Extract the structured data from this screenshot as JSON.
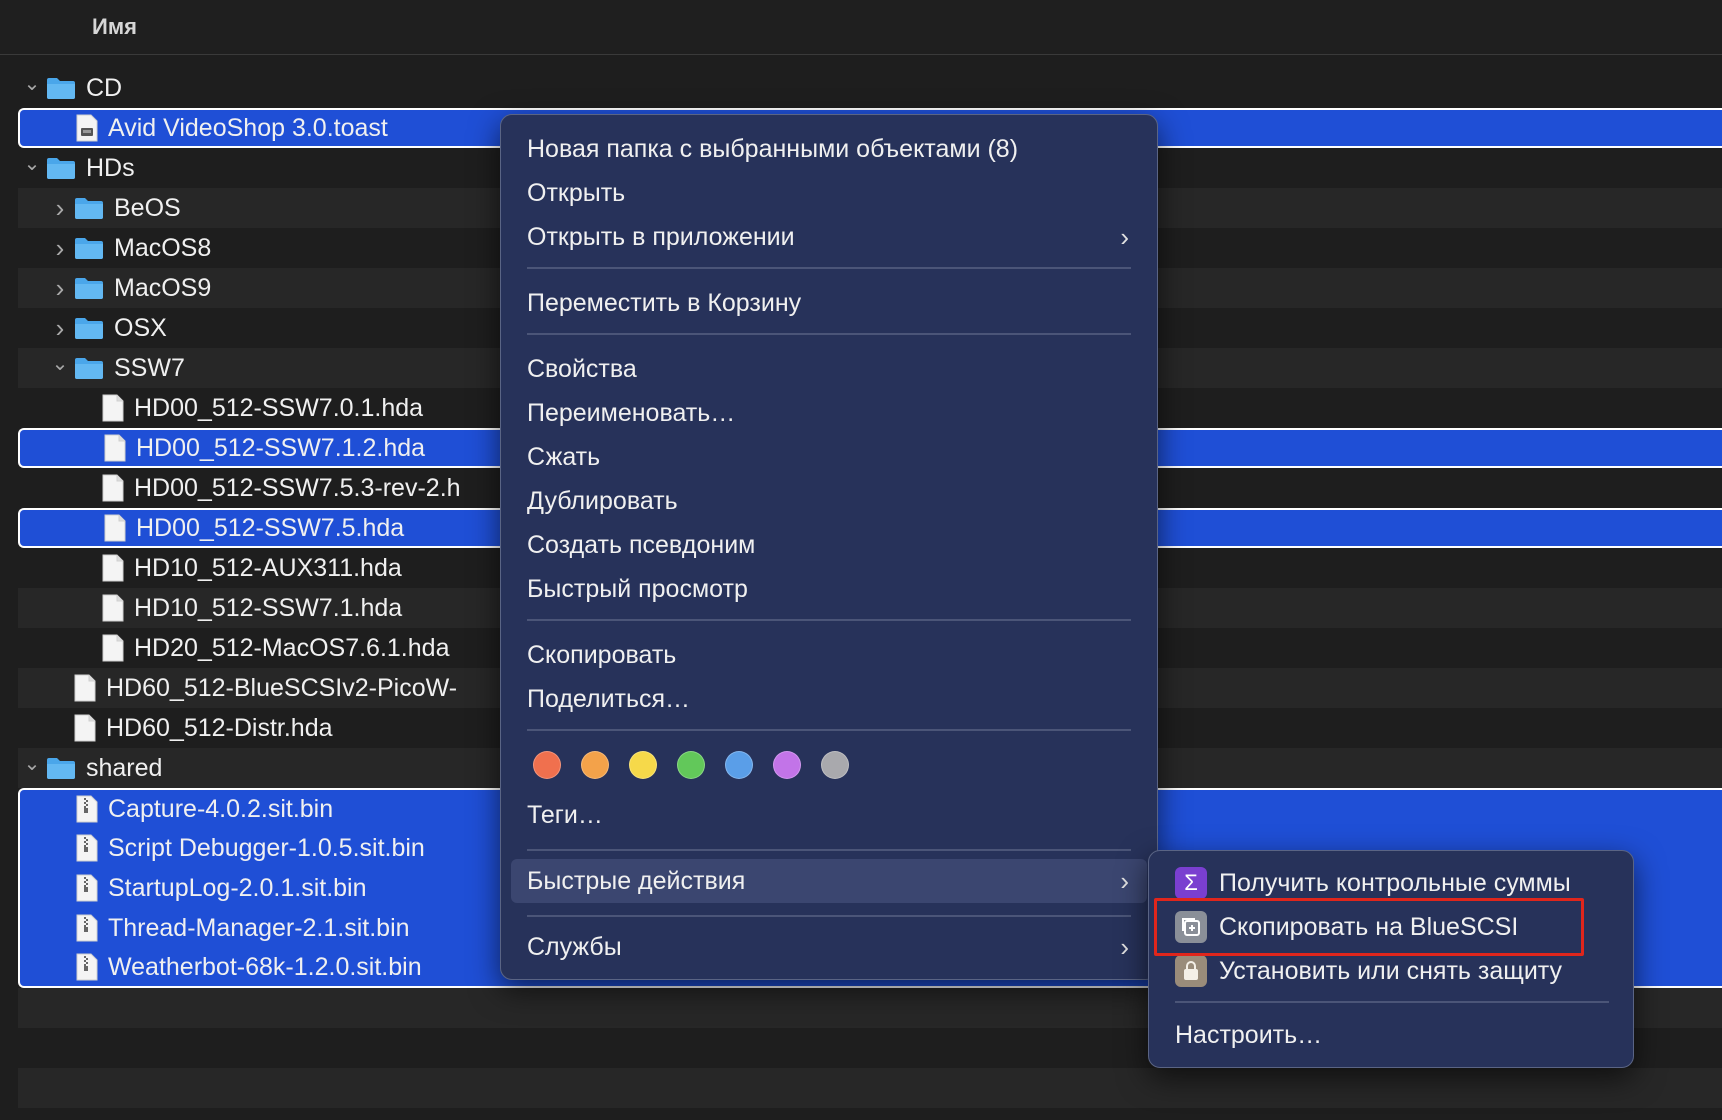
{
  "header": {
    "name_column": "Имя"
  },
  "colors": {
    "selection": "#1f4fd6",
    "menu_bg": "#27325a",
    "highlight_box": "#e0261c",
    "folder": "#4aa6ea"
  },
  "files": [
    {
      "name": "CD",
      "kind": "folder",
      "level": 0,
      "disclosure": "open",
      "selected": false
    },
    {
      "name": "Avid VideoShop 3.0.toast",
      "kind": "disk",
      "level": 1,
      "disclosure": "none",
      "selected": true
    },
    {
      "name": "HDs",
      "kind": "folder",
      "level": 0,
      "disclosure": "open",
      "selected": false
    },
    {
      "name": "BeOS",
      "kind": "folder",
      "level": 1,
      "disclosure": "closed",
      "selected": false
    },
    {
      "name": "MacOS8",
      "kind": "folder",
      "level": 1,
      "disclosure": "closed",
      "selected": false
    },
    {
      "name": "MacOS9",
      "kind": "folder",
      "level": 1,
      "disclosure": "closed",
      "selected": false
    },
    {
      "name": "OSX",
      "kind": "folder",
      "level": 1,
      "disclosure": "closed",
      "selected": false
    },
    {
      "name": "SSW7",
      "kind": "folder",
      "level": 1,
      "disclosure": "open",
      "selected": false
    },
    {
      "name": "HD00_512-SSW7.0.1.hda",
      "kind": "file",
      "level": 2,
      "disclosure": "none",
      "selected": false
    },
    {
      "name": "HD00_512-SSW7.1.2.hda",
      "kind": "file",
      "level": 2,
      "disclosure": "none",
      "selected": true
    },
    {
      "name": "HD00_512-SSW7.5.3-rev-2.h",
      "kind": "file",
      "level": 2,
      "disclosure": "none",
      "selected": false
    },
    {
      "name": "HD00_512-SSW7.5.hda",
      "kind": "file",
      "level": 2,
      "disclosure": "none",
      "selected": true
    },
    {
      "name": "HD10_512-AUX311.hda",
      "kind": "file",
      "level": 2,
      "disclosure": "none",
      "selected": false
    },
    {
      "name": "HD10_512-SSW7.1.hda",
      "kind": "file",
      "level": 2,
      "disclosure": "none",
      "selected": false
    },
    {
      "name": "HD20_512-MacOS7.6.1.hda",
      "kind": "file",
      "level": 2,
      "disclosure": "none",
      "selected": false
    },
    {
      "name": "HD60_512-BlueSCSIv2-PicoW-",
      "kind": "file",
      "level": 1,
      "disclosure": "none",
      "selected": false
    },
    {
      "name": "HD60_512-Distr.hda",
      "kind": "file",
      "level": 1,
      "disclosure": "none",
      "selected": false
    },
    {
      "name": "shared",
      "kind": "folder",
      "level": 0,
      "disclosure": "open",
      "selected": false
    },
    {
      "name": "Capture-4.0.2.sit.bin",
      "kind": "archive",
      "level": 1,
      "disclosure": "none",
      "selected": true
    },
    {
      "name": "Script Debugger-1.0.5.sit.bin",
      "kind": "archive",
      "level": 1,
      "disclosure": "none",
      "selected": true
    },
    {
      "name": "StartupLog-2.0.1.sit.bin",
      "kind": "archive",
      "level": 1,
      "disclosure": "none",
      "selected": true
    },
    {
      "name": "Thread-Manager-2.1.sit.bin",
      "kind": "archive",
      "level": 1,
      "disclosure": "none",
      "selected": true
    },
    {
      "name": "Weatherbot-68k-1.2.0.sit.bin",
      "kind": "archive",
      "level": 1,
      "disclosure": "none",
      "selected": true
    }
  ],
  "context_menu": {
    "new_folder": "Новая папка с выбранными объектами (8)",
    "open": "Открыть",
    "open_with": "Открыть в приложении",
    "move_to_trash": "Переместить в Корзину",
    "get_info": "Свойства",
    "rename": "Переименовать…",
    "compress": "Сжать",
    "duplicate": "Дублировать",
    "make_alias": "Создать псевдоним",
    "quick_look": "Быстрый просмотр",
    "copy": "Скопировать",
    "share": "Поделиться…",
    "tag_colors": [
      {
        "name": "red",
        "color": "#f0704e"
      },
      {
        "name": "orange",
        "color": "#f3a24a"
      },
      {
        "name": "yellow",
        "color": "#f6d94a"
      },
      {
        "name": "green",
        "color": "#62c85a"
      },
      {
        "name": "blue",
        "color": "#5a9ee8"
      },
      {
        "name": "purple",
        "color": "#c274e8"
      },
      {
        "name": "gray",
        "color": "#a9a9ad"
      }
    ],
    "tags": "Теги…",
    "quick_actions": "Быстрые действия",
    "services": "Службы"
  },
  "quick_actions_menu": {
    "checksums": "Получить контрольные суммы",
    "copy_to_bluescsi": "Скопировать на BlueSCSI",
    "lock_unlock": "Установить или снять защиту",
    "customize": "Настроить…"
  }
}
